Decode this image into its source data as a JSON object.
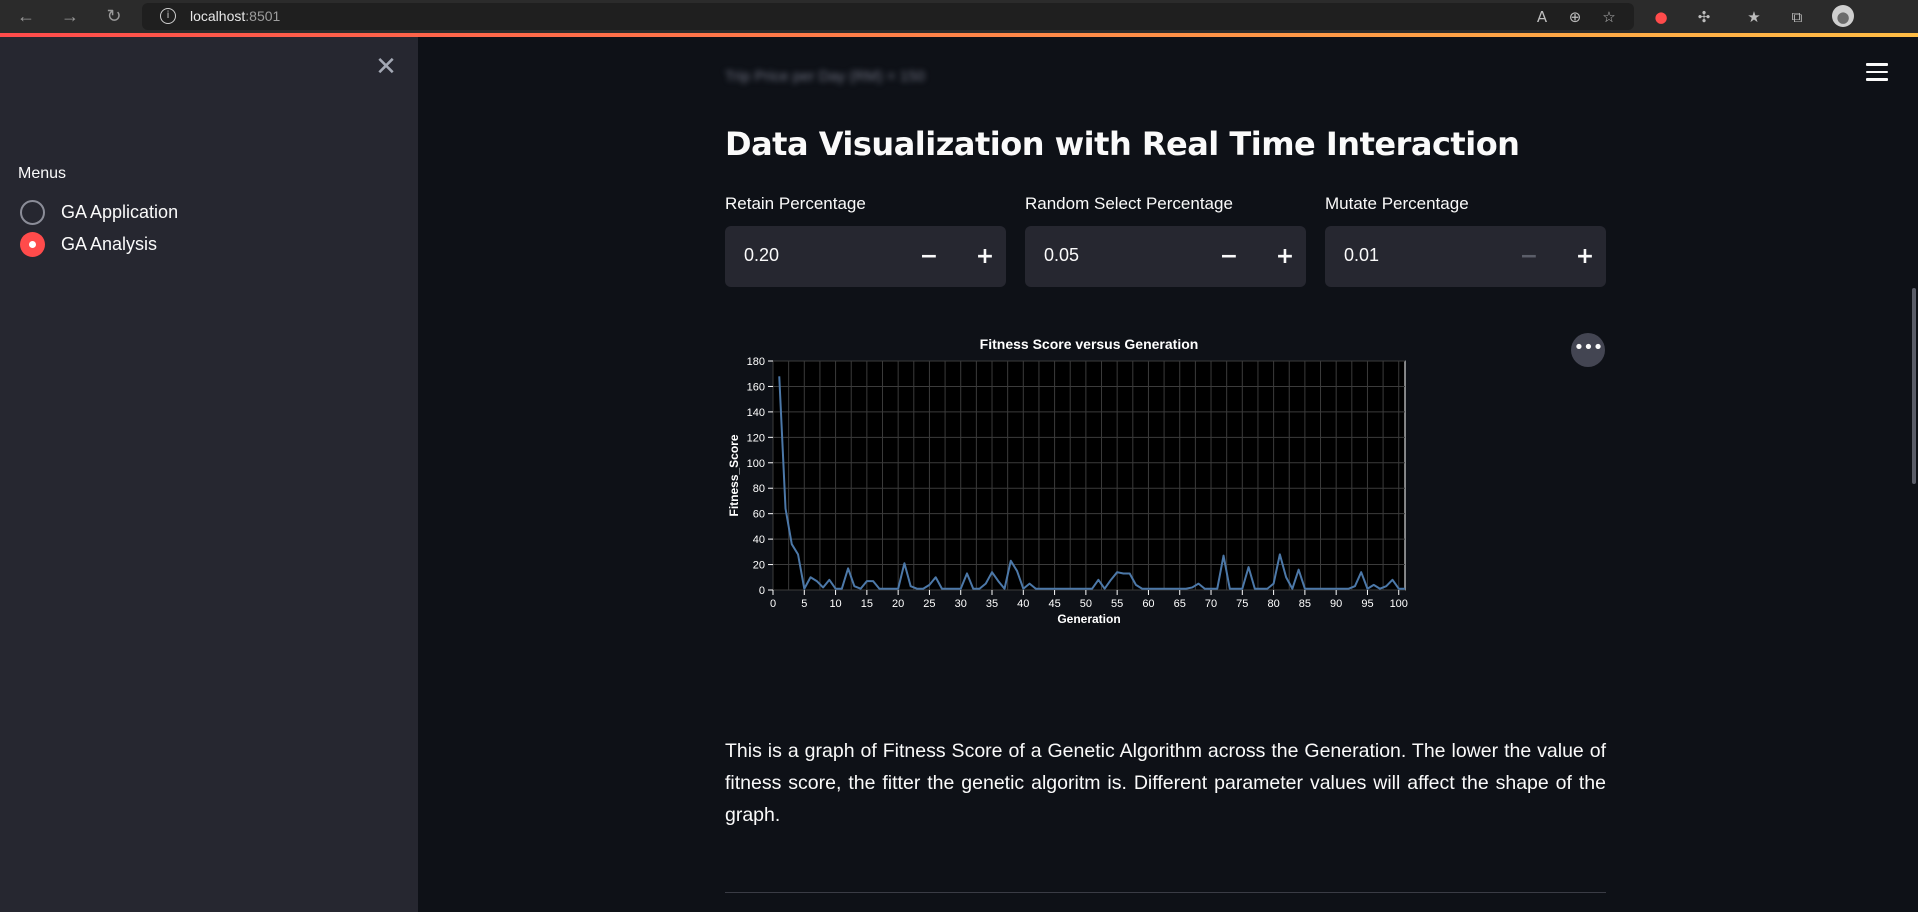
{
  "browser": {
    "url_host": "localhost",
    "url_port": ":8501"
  },
  "sidebar": {
    "menu_label": "Menus",
    "options": [
      {
        "label": "GA Application",
        "selected": false
      },
      {
        "label": "GA Analysis",
        "selected": true
      }
    ]
  },
  "main": {
    "blurred_text": "Trip Price per Day (RM) = 150",
    "title": "Data Visualization with Real Time Interaction",
    "inputs": [
      {
        "label": "Retain Percentage",
        "value": "0.20",
        "minus_disabled": false
      },
      {
        "label": "Random Select Percentage",
        "value": "0.05",
        "minus_disabled": false
      },
      {
        "label": "Mutate Percentage",
        "value": "0.01",
        "minus_disabled": true
      }
    ],
    "description": "This is a graph of Fitness Score of a Genetic Algorithm across the Generation. The lower the value of fitness score, the fitter the genetic algoritm is. Different parameter values will affect the shape of the graph."
  },
  "colors": {
    "accent": "#ff4b4b",
    "line": "#4c78a8",
    "background": "#0e1117",
    "sidebar": "#262730"
  },
  "chart_data": {
    "type": "line",
    "title": "Fitness Score versus Generation",
    "xlabel": "Generation",
    "ylabel": "Fitness_Score",
    "xlim": [
      0,
      101
    ],
    "ylim": [
      0,
      180
    ],
    "xticks": [
      0,
      5,
      10,
      15,
      20,
      25,
      30,
      35,
      40,
      45,
      50,
      55,
      60,
      65,
      70,
      75,
      80,
      85,
      90,
      95,
      100
    ],
    "yticks": [
      0,
      20,
      40,
      60,
      80,
      100,
      120,
      140,
      160,
      180
    ],
    "grid": true,
    "x": [
      1,
      2,
      3,
      4,
      5,
      6,
      7,
      8,
      9,
      10,
      11,
      12,
      13,
      14,
      15,
      16,
      17,
      18,
      19,
      20,
      21,
      22,
      23,
      24,
      25,
      26,
      27,
      28,
      29,
      30,
      31,
      32,
      33,
      34,
      35,
      36,
      37,
      38,
      39,
      40,
      41,
      42,
      43,
      44,
      45,
      46,
      47,
      48,
      49,
      50,
      51,
      52,
      53,
      54,
      55,
      56,
      57,
      58,
      59,
      60,
      61,
      62,
      63,
      64,
      65,
      66,
      67,
      68,
      69,
      70,
      71,
      72,
      73,
      74,
      75,
      76,
      77,
      78,
      79,
      80,
      81,
      82,
      83,
      84,
      85,
      86,
      87,
      88,
      89,
      90,
      91,
      92,
      93,
      94,
      95,
      96,
      97,
      98,
      99,
      100,
      101
    ],
    "values": [
      168,
      64,
      36,
      28,
      1,
      10,
      7,
      2,
      8,
      1,
      1,
      17,
      3,
      1,
      7,
      7,
      1,
      1,
      1,
      1,
      21,
      3,
      1,
      1,
      4,
      10,
      1,
      1,
      1,
      1,
      13,
      1,
      1,
      5,
      14,
      7,
      1,
      23,
      15,
      1,
      5,
      1,
      1,
      1,
      1,
      1,
      1,
      1,
      1,
      1,
      1,
      8,
      1,
      8,
      14,
      13,
      13,
      4,
      1,
      1,
      1,
      1,
      1,
      1,
      1,
      1,
      2,
      5,
      1,
      1,
      1,
      27,
      1,
      1,
      1,
      18,
      1,
      1,
      1,
      5,
      28,
      10,
      1,
      16,
      1,
      1,
      1,
      1,
      1,
      1,
      1,
      1,
      3,
      14,
      1,
      4,
      1,
      3,
      8,
      1,
      1
    ]
  }
}
